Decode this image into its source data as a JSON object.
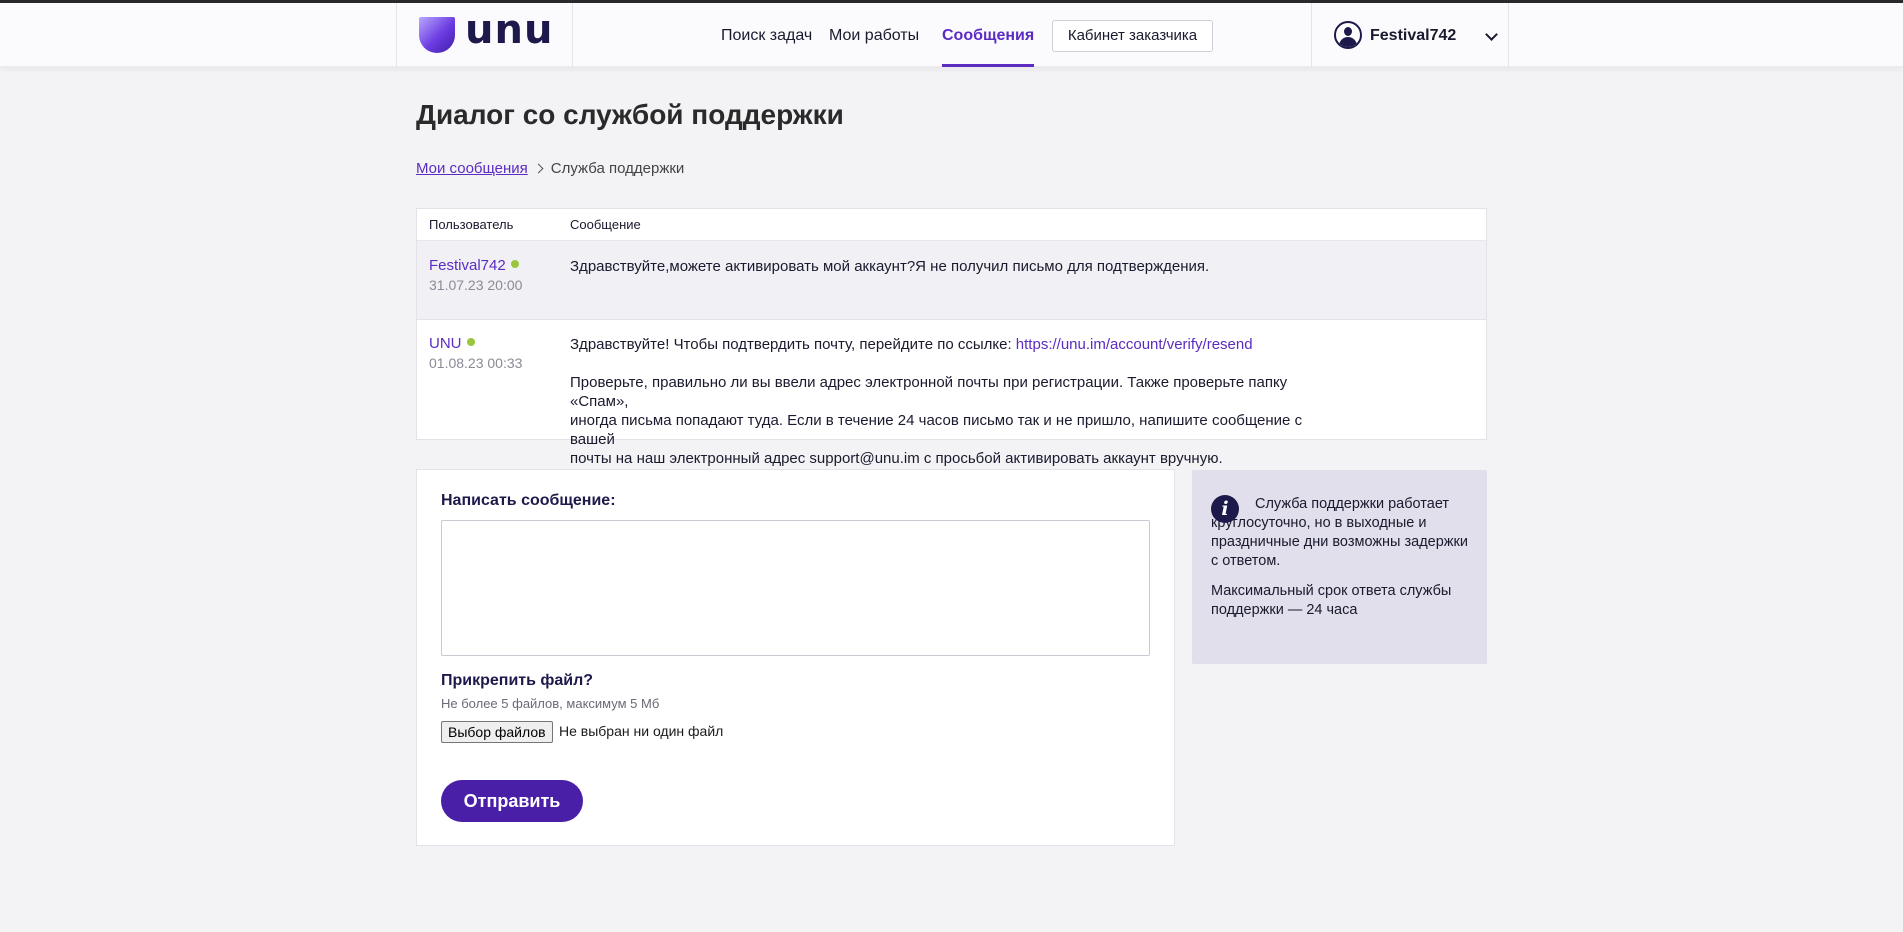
{
  "header": {
    "logo_text": "unu",
    "nav": [
      {
        "label": "Поиск задач",
        "active": false
      },
      {
        "label": "Мои работы",
        "active": false
      },
      {
        "label": "Сообщения",
        "active": true
      }
    ],
    "cabinet_button": "Кабинет заказчика",
    "user_name": "Festival742"
  },
  "page": {
    "title": "Диалог со службой поддержки",
    "breadcrumb": {
      "link": "Мои сообщения",
      "current": "Служба поддержки"
    }
  },
  "messages": {
    "columns": [
      "Пользователь",
      "Сообщение"
    ],
    "rows": [
      {
        "author": "Festival742",
        "date": "31.07.23 20:00",
        "text": "Здравствуйте,можете активировать мой аккаунт?Я не получил письмо для подтверждения."
      },
      {
        "author": "UNU",
        "date": "01.08.23 00:33",
        "text_prefix": "Здравствуйте! Чтобы подтвердить почту, перейдите по ссылке: ",
        "link": "https://unu.im/account/verify/resend",
        "text_line1": "Проверьте, правильно ли вы ввели адрес электронной почты при регистрации. Также проверьте папку «Спам»,",
        "text_line2": "иногда письма попадают туда. Если в течение 24 часов письмо так и не пришло, напишите сообщение с вашей",
        "text_line3": "почты на наш электронный адрес support@unu.im с просьбой активировать аккаунт вручную."
      }
    ]
  },
  "compose": {
    "label": "Написать сообщение:",
    "textarea_value": "",
    "attach_label": "Прикрепить файл?",
    "attach_hint": "Не более 5 файлов, максимум 5 Мб",
    "file_button": "Выбор файлов",
    "file_status": "Не выбран ни один файл",
    "submit": "Отправить"
  },
  "info": {
    "icon": "i",
    "text1": "Служба поддержки работает круглосуточно, но в выходные и праздничные дни возможны задержки с ответом.",
    "text2": "Максимальный срок ответа службы поддержки — 24 часа"
  },
  "colors": {
    "accent": "#5b2bc2",
    "button": "#4a1fa8",
    "online": "#9bc53d"
  }
}
